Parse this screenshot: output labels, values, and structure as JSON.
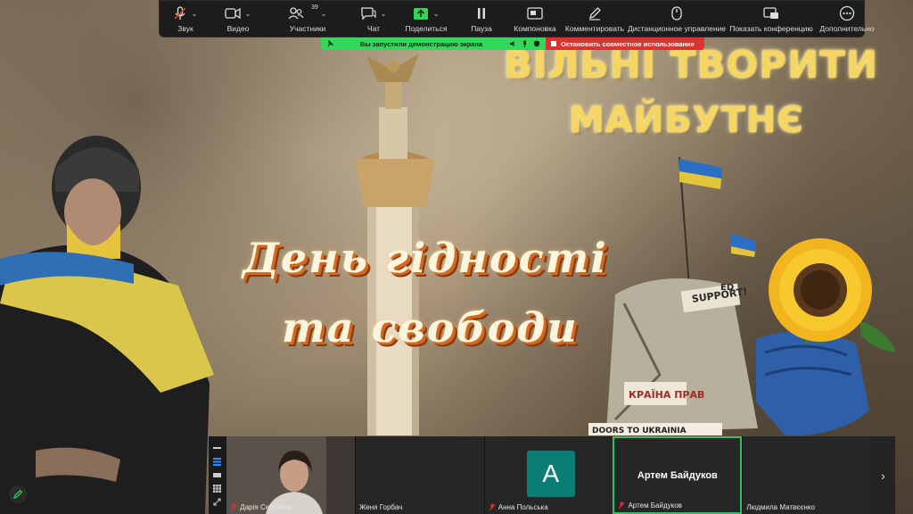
{
  "toolbar": {
    "items": [
      {
        "label": "Звук",
        "icon": "mic-muted-icon"
      },
      {
        "label": "Видео",
        "icon": "video-camera-icon"
      },
      {
        "label": "Участники",
        "icon": "participants-icon",
        "count": "39"
      },
      {
        "label": "Чат",
        "icon": "chat-icon"
      },
      {
        "label": "Поделиться",
        "icon": "share-screen-icon"
      },
      {
        "label": "Пауза",
        "icon": "pause-icon"
      },
      {
        "label": "Компоновка",
        "icon": "layout-icon"
      },
      {
        "label": "Комментировать",
        "icon": "annotate-icon"
      },
      {
        "label": "Дистанционное управление",
        "icon": "remote-control-icon"
      },
      {
        "label": "Показать конференцию",
        "icon": "show-meeting-icon"
      },
      {
        "label": "Дополнительно",
        "icon": "more-icon"
      }
    ]
  },
  "share_banner": {
    "message": "Вы запустили демонстрацию экрана",
    "stop_label": "Остановить совместное использование"
  },
  "slide": {
    "title_line1": "ВІЛЬНІ ТВОРИТИ",
    "title_line2": "МАЙБУТНЄ",
    "center_line1": "День гідності",
    "center_line2": "та свободи",
    "banner_support": "SUPPORT!",
    "banner_doors": "DOORS TO UKRAINIA",
    "banner_ukraine": "КРАЇНА ПРАВ",
    "banner_ed": "ED"
  },
  "participants": [
    {
      "name": "Дарія Сергіївна",
      "muted": true,
      "video": true
    },
    {
      "name": "Женя Горбач",
      "muted": false,
      "video": false
    },
    {
      "name": "Анна Польська",
      "muted": true,
      "avatar_letter": "A"
    },
    {
      "name": "Артем Байдуков",
      "muted": true,
      "active": true
    },
    {
      "name": "Людмила Матвєєнко",
      "muted": false,
      "video": false
    }
  ],
  "colors": {
    "toolbar_bg": "#1c1c1c",
    "share_green": "#2fd95a",
    "stop_red": "#e0312f",
    "active_speaker": "#27c36b",
    "avatar_teal": "#0a7d74",
    "title_gold": "#f6d563"
  }
}
